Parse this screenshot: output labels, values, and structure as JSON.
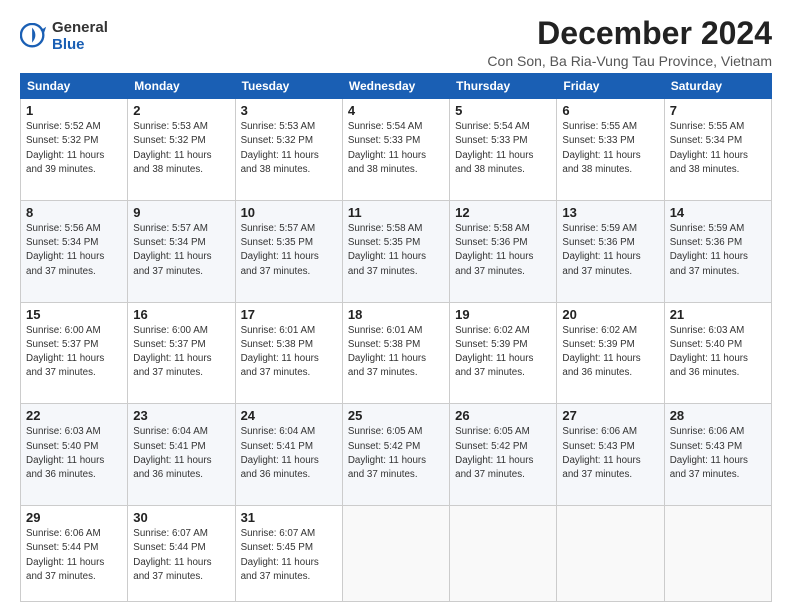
{
  "logo": {
    "general": "General",
    "blue": "Blue"
  },
  "title": "December 2024",
  "subtitle": "Con Son, Ba Ria-Vung Tau Province, Vietnam",
  "days_header": [
    "Sunday",
    "Monday",
    "Tuesday",
    "Wednesday",
    "Thursday",
    "Friday",
    "Saturday"
  ],
  "weeks": [
    [
      {
        "day": "1",
        "sunrise": "5:52 AM",
        "sunset": "5:32 PM",
        "daylight": "11 hours and 39 minutes."
      },
      {
        "day": "2",
        "sunrise": "5:53 AM",
        "sunset": "5:32 PM",
        "daylight": "11 hours and 38 minutes."
      },
      {
        "day": "3",
        "sunrise": "5:53 AM",
        "sunset": "5:32 PM",
        "daylight": "11 hours and 38 minutes."
      },
      {
        "day": "4",
        "sunrise": "5:54 AM",
        "sunset": "5:33 PM",
        "daylight": "11 hours and 38 minutes."
      },
      {
        "day": "5",
        "sunrise": "5:54 AM",
        "sunset": "5:33 PM",
        "daylight": "11 hours and 38 minutes."
      },
      {
        "day": "6",
        "sunrise": "5:55 AM",
        "sunset": "5:33 PM",
        "daylight": "11 hours and 38 minutes."
      },
      {
        "day": "7",
        "sunrise": "5:55 AM",
        "sunset": "5:34 PM",
        "daylight": "11 hours and 38 minutes."
      }
    ],
    [
      {
        "day": "8",
        "sunrise": "5:56 AM",
        "sunset": "5:34 PM",
        "daylight": "11 hours and 37 minutes."
      },
      {
        "day": "9",
        "sunrise": "5:57 AM",
        "sunset": "5:34 PM",
        "daylight": "11 hours and 37 minutes."
      },
      {
        "day": "10",
        "sunrise": "5:57 AM",
        "sunset": "5:35 PM",
        "daylight": "11 hours and 37 minutes."
      },
      {
        "day": "11",
        "sunrise": "5:58 AM",
        "sunset": "5:35 PM",
        "daylight": "11 hours and 37 minutes."
      },
      {
        "day": "12",
        "sunrise": "5:58 AM",
        "sunset": "5:36 PM",
        "daylight": "11 hours and 37 minutes."
      },
      {
        "day": "13",
        "sunrise": "5:59 AM",
        "sunset": "5:36 PM",
        "daylight": "11 hours and 37 minutes."
      },
      {
        "day": "14",
        "sunrise": "5:59 AM",
        "sunset": "5:36 PM",
        "daylight": "11 hours and 37 minutes."
      }
    ],
    [
      {
        "day": "15",
        "sunrise": "6:00 AM",
        "sunset": "5:37 PM",
        "daylight": "11 hours and 37 minutes."
      },
      {
        "day": "16",
        "sunrise": "6:00 AM",
        "sunset": "5:37 PM",
        "daylight": "11 hours and 37 minutes."
      },
      {
        "day": "17",
        "sunrise": "6:01 AM",
        "sunset": "5:38 PM",
        "daylight": "11 hours and 37 minutes."
      },
      {
        "day": "18",
        "sunrise": "6:01 AM",
        "sunset": "5:38 PM",
        "daylight": "11 hours and 37 minutes."
      },
      {
        "day": "19",
        "sunrise": "6:02 AM",
        "sunset": "5:39 PM",
        "daylight": "11 hours and 37 minutes."
      },
      {
        "day": "20",
        "sunrise": "6:02 AM",
        "sunset": "5:39 PM",
        "daylight": "11 hours and 36 minutes."
      },
      {
        "day": "21",
        "sunrise": "6:03 AM",
        "sunset": "5:40 PM",
        "daylight": "11 hours and 36 minutes."
      }
    ],
    [
      {
        "day": "22",
        "sunrise": "6:03 AM",
        "sunset": "5:40 PM",
        "daylight": "11 hours and 36 minutes."
      },
      {
        "day": "23",
        "sunrise": "6:04 AM",
        "sunset": "5:41 PM",
        "daylight": "11 hours and 36 minutes."
      },
      {
        "day": "24",
        "sunrise": "6:04 AM",
        "sunset": "5:41 PM",
        "daylight": "11 hours and 36 minutes."
      },
      {
        "day": "25",
        "sunrise": "6:05 AM",
        "sunset": "5:42 PM",
        "daylight": "11 hours and 37 minutes."
      },
      {
        "day": "26",
        "sunrise": "6:05 AM",
        "sunset": "5:42 PM",
        "daylight": "11 hours and 37 minutes."
      },
      {
        "day": "27",
        "sunrise": "6:06 AM",
        "sunset": "5:43 PM",
        "daylight": "11 hours and 37 minutes."
      },
      {
        "day": "28",
        "sunrise": "6:06 AM",
        "sunset": "5:43 PM",
        "daylight": "11 hours and 37 minutes."
      }
    ],
    [
      {
        "day": "29",
        "sunrise": "6:06 AM",
        "sunset": "5:44 PM",
        "daylight": "11 hours and 37 minutes."
      },
      {
        "day": "30",
        "sunrise": "6:07 AM",
        "sunset": "5:44 PM",
        "daylight": "11 hours and 37 minutes."
      },
      {
        "day": "31",
        "sunrise": "6:07 AM",
        "sunset": "5:45 PM",
        "daylight": "11 hours and 37 minutes."
      },
      null,
      null,
      null,
      null
    ]
  ]
}
